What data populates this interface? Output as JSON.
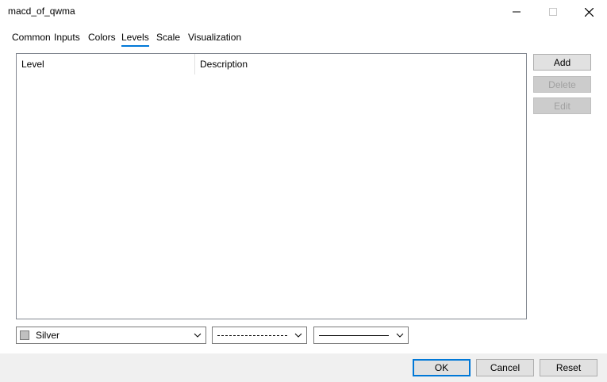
{
  "window": {
    "title": "macd_of_qwma"
  },
  "tabs": [
    {
      "label": "Common",
      "active": false
    },
    {
      "label": "Inputs",
      "active": false
    },
    {
      "label": "Colors",
      "active": false
    },
    {
      "label": "Levels",
      "active": true
    },
    {
      "label": "Scale",
      "active": false
    },
    {
      "label": "Visualization",
      "active": false
    }
  ],
  "levels": {
    "columns": [
      "Level",
      "Description"
    ],
    "rows": []
  },
  "side_buttons": {
    "add": "Add",
    "delete": "Delete",
    "edit": "Edit"
  },
  "line_settings": {
    "color": {
      "label": "Silver",
      "value": "#c0c0c0"
    },
    "style": "dashed",
    "width": "solid-thin"
  },
  "dialog_buttons": {
    "ok": "OK",
    "cancel": "Cancel",
    "reset": "Reset"
  },
  "colors": {
    "accent": "#0078d7",
    "button_bg": "#e1e1e1",
    "footer_bg": "#f0f0f0"
  }
}
